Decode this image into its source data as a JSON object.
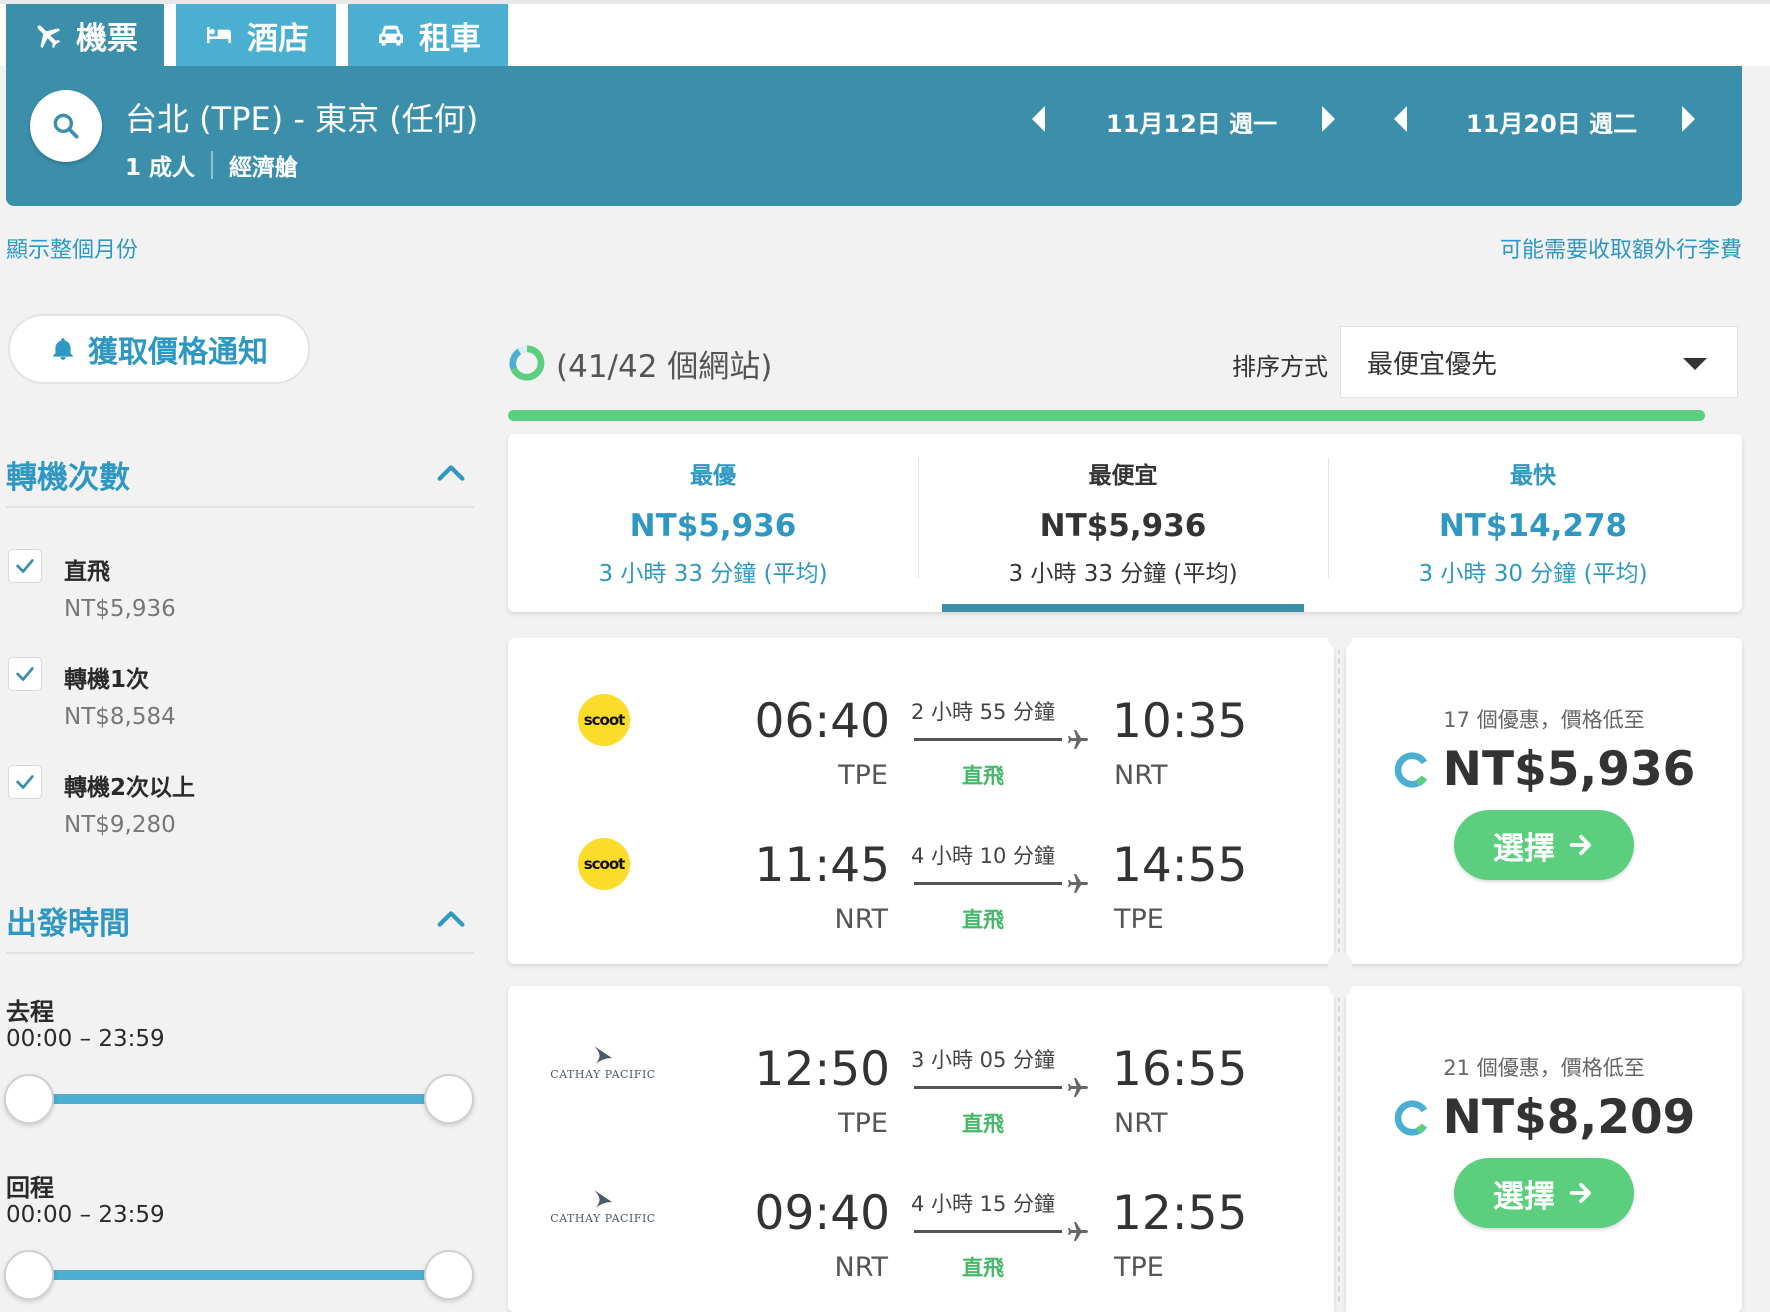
{
  "tabs": [
    {
      "label": "機票",
      "icon": "plane-icon"
    },
    {
      "label": "酒店",
      "icon": "bed-icon"
    },
    {
      "label": "租車",
      "icon": "car-icon"
    }
  ],
  "search": {
    "route": "台北 (TPE) - 東京 (任何)",
    "adults": "1 成人",
    "cabin": "經濟艙",
    "depart_date": "11月12日 週一",
    "return_date": "11月20日 週二"
  },
  "links": {
    "show_month": "顯示整個月份",
    "baggage_fees": "可能需要收取額外行李費"
  },
  "alert_button": "獲取價格通知",
  "filters": {
    "stops_title": "轉機次數",
    "stops": [
      {
        "label": "直飛",
        "price": "NT$5,936",
        "checked": true
      },
      {
        "label": "轉機1次",
        "price": "NT$8,584",
        "checked": true
      },
      {
        "label": "轉機2次以上",
        "price": "NT$9,280",
        "checked": true
      }
    ],
    "times_title": "出發時間",
    "outbound_label": "去程",
    "outbound_range": "00:00 – 23:59",
    "return_label": "回程",
    "return_range": "00:00 – 23:59"
  },
  "results_header": {
    "site_count": "(41/42 個網站)",
    "sort_label": "排序方式",
    "sort_value": "最便宜優先",
    "progress": 0.976
  },
  "summary": [
    {
      "title": "最優",
      "price": "NT$5,936",
      "duration": "3 小時 33 分鐘 (平均)",
      "selected": false
    },
    {
      "title": "最便宜",
      "price": "NT$5,936",
      "duration": "3 小時 33 分鐘 (平均)",
      "selected": true
    },
    {
      "title": "最快",
      "price": "NT$14,278",
      "duration": "3 小時 30 分鐘 (平均)",
      "selected": false
    }
  ],
  "results": [
    {
      "legs": [
        {
          "airline": "scoot",
          "dep_time": "06:40",
          "dep_code": "TPE",
          "duration": "2 小時 55 分鐘",
          "stops": "直飛",
          "arr_time": "10:35",
          "arr_code": "NRT"
        },
        {
          "airline": "scoot",
          "dep_time": "11:45",
          "dep_code": "NRT",
          "duration": "4 小時 10 分鐘",
          "stops": "直飛",
          "arr_time": "14:55",
          "arr_code": "TPE"
        }
      ],
      "deals": "17 個優惠，價格低至",
      "price": "NT$5,936",
      "select_label": "選擇"
    },
    {
      "legs": [
        {
          "airline": "CATHAY PACIFIC",
          "dep_time": "12:50",
          "dep_code": "TPE",
          "duration": "3 小時 05 分鐘",
          "stops": "直飛",
          "arr_time": "16:55",
          "arr_code": "NRT"
        },
        {
          "airline": "CATHAY PACIFIC",
          "dep_time": "09:40",
          "dep_code": "NRT",
          "duration": "4 小時 15 分鐘",
          "stops": "直飛",
          "arr_time": "12:55",
          "arr_code": "TPE"
        }
      ],
      "deals": "21 個優惠，價格低至",
      "price": "NT$8,209",
      "select_label": "選擇"
    }
  ],
  "colors": {
    "primary": "#3b8fab",
    "tab_inactive": "#4aafd1",
    "link": "#2f98c2",
    "green": "#5ccf7f",
    "scoot_yellow": "#fbdc2b"
  }
}
